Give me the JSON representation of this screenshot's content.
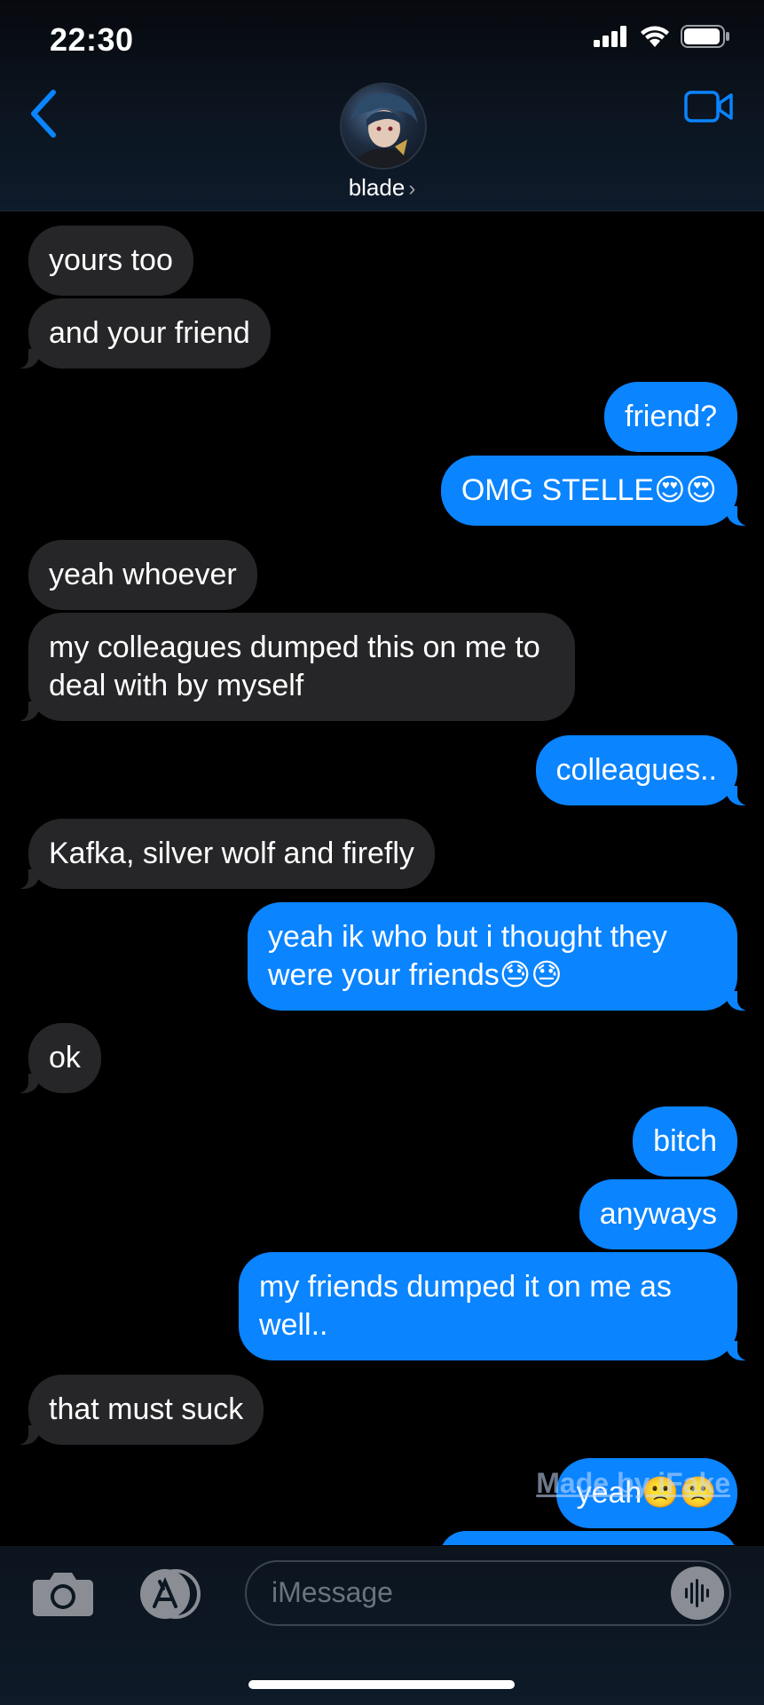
{
  "status_bar": {
    "time": "22:30"
  },
  "header": {
    "contact_name": "blade",
    "chevron": "›",
    "back_icon": "chevron-left-icon",
    "video_icon": "video-camera-icon",
    "accent_color": "#0a84ff"
  },
  "messages": [
    {
      "from": "them",
      "text": "yours too"
    },
    {
      "from": "them",
      "text": "and your friend"
    },
    {
      "from": "me",
      "text": "friend?"
    },
    {
      "from": "me",
      "text": "OMG STELLE😍😍"
    },
    {
      "from": "them",
      "text": "yeah whoever"
    },
    {
      "from": "them",
      "text": "my colleagues dumped this on me to deal with by myself"
    },
    {
      "from": "me",
      "text": "colleagues.."
    },
    {
      "from": "them",
      "text": "Kafka, silver wolf and firefly"
    },
    {
      "from": "me",
      "text": "yeah ik who but i thought they were your friends😓😓"
    },
    {
      "from": "them",
      "text": "ok"
    },
    {
      "from": "me",
      "text": "bitch"
    },
    {
      "from": "me",
      "text": "anyways"
    },
    {
      "from": "me",
      "text": "my friends dumped it on me as well.."
    },
    {
      "from": "them",
      "text": "that must suck"
    },
    {
      "from": "me",
      "text": "yeah🙁🙁"
    }
  ],
  "watermark": "Made by iFake",
  "input_bar": {
    "placeholder": "iMessage",
    "camera_icon": "camera-icon",
    "apps_icon": "app-store-icon",
    "audio_icon": "waveform-icon"
  }
}
